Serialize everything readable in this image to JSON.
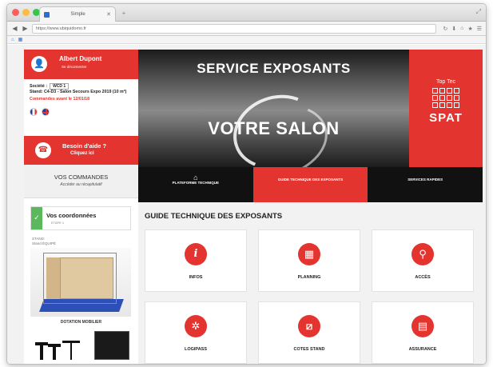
{
  "browser": {
    "tab_title": "Simple",
    "url": "https://www.ubiquidomo.fr",
    "new_tab_label": "+"
  },
  "user": {
    "name": "Albert Dupont",
    "logout": "Se déconnecter"
  },
  "info": {
    "company_label": "Société :",
    "company_value": "WCD 1",
    "stand_line": "Stand: C4-D3 - Salon Secours Expo 2019 (10 m²)",
    "deadline": "Commandes avant le 12/01/18"
  },
  "help": {
    "title": "Besoin d'aide ?",
    "subtitle": "Cliquez ici"
  },
  "orders": {
    "title": "VOS COMMANDES",
    "subtitle": "Accéder au récapitulatif"
  },
  "coords": {
    "title": "Vos coordonnées",
    "step": "ETAPE 1"
  },
  "stand": {
    "label": "STAND:",
    "type": "Stand ÉQUIPÉ",
    "furniture_title": "DOTATION MOBILIER"
  },
  "banner": {
    "title": "SERVICE EXPOSANTS",
    "subtitle": "VOTRE SALON",
    "spat_top": "Top Tec",
    "spat_logo": "SPAT"
  },
  "nav": {
    "items": [
      {
        "label": "PLATEFORME TECHNIQUE"
      },
      {
        "label": "GUIDE TECHNIQUE DES EXPOSANTS"
      },
      {
        "label": "SERVICES RAPIDES"
      }
    ]
  },
  "guide": {
    "title": "GUIDE TECHNIQUE DES EXPOSANTS",
    "tiles": [
      {
        "label": "INFOS",
        "icon": "info-icon"
      },
      {
        "label": "PLANNING",
        "icon": "calendar-icon"
      },
      {
        "label": "ACCÈS",
        "icon": "map-pin-icon"
      },
      {
        "label": "LOGIPASS",
        "icon": "badge-icon"
      },
      {
        "label": "COTES STAND",
        "icon": "ruler-icon"
      },
      {
        "label": "ASSURANCE",
        "icon": "document-icon"
      }
    ]
  },
  "colors": {
    "accent": "#e3342f",
    "dark": "#111111",
    "success": "#5cb85c"
  }
}
